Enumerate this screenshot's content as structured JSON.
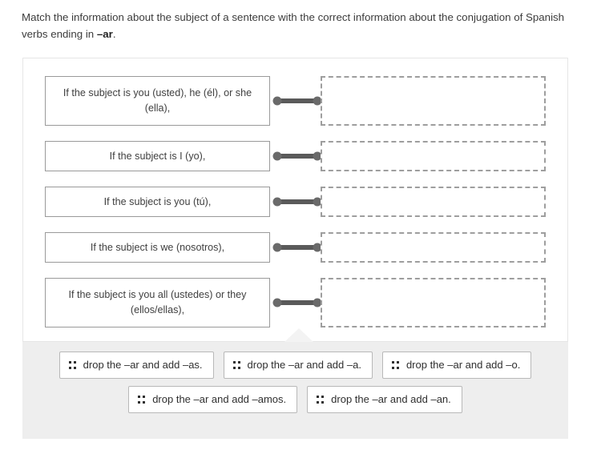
{
  "prompt": {
    "text_before": "Match the information about the subject of a sentence with the correct information about the conjugation of Spanish verbs ending in ",
    "emphasis": "–ar",
    "text_after": "."
  },
  "match_panel": {
    "rows": [
      {
        "prompt_label": "If the subject is you (usted), he (él), or she (ella),",
        "dropzone_value": "",
        "connector_icon": "link-connector-icon"
      },
      {
        "prompt_label": "If the subject is I (yo),",
        "dropzone_value": "",
        "connector_icon": "link-connector-icon"
      },
      {
        "prompt_label": "If the subject is you (tú),",
        "dropzone_value": "",
        "connector_icon": "link-connector-icon"
      },
      {
        "prompt_label": "If the subject is we (nosotros),",
        "dropzone_value": "",
        "connector_icon": "link-connector-icon"
      },
      {
        "prompt_label": "If the subject is you all (ustedes) or they (ellos/ellas),",
        "dropzone_value": "",
        "connector_icon": "link-connector-icon"
      }
    ]
  },
  "tray": {
    "rows": [
      [
        {
          "label": "drop the –ar and add –as.",
          "grip_icon": "drag-grip-icon"
        },
        {
          "label": "drop the –ar and add –a.",
          "grip_icon": "drag-grip-icon"
        },
        {
          "label": "drop the –ar and add –o.",
          "grip_icon": "drag-grip-icon"
        }
      ],
      [
        {
          "label": "drop the –ar and add –amos.",
          "grip_icon": "drag-grip-icon"
        },
        {
          "label": "drop the –ar and add –an.",
          "grip_icon": "drag-grip-icon"
        }
      ]
    ]
  },
  "colors": {
    "panel_border": "#e6e6e6",
    "box_border": "#9a9a9a",
    "dropzone_border": "#9e9e9e",
    "connector": "#5a5a5a",
    "tray_background": "#eeeeee",
    "text": "#3c3c3c"
  }
}
